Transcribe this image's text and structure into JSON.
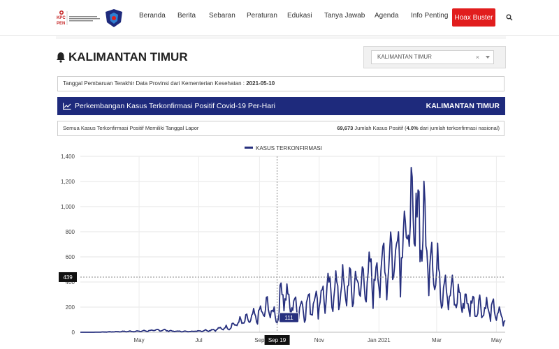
{
  "nav": {
    "logo_text": "KOMITE PENANGANAN COVID-19 DAN PEMULIHAN EKONOMI NASIONAL",
    "items": [
      "Beranda",
      "Berita",
      "Sebaran",
      "Peraturan",
      "Edukasi",
      "Tanya Jawab",
      "Agenda",
      "Info Penting"
    ],
    "hoax_label": "Hoax Buster"
  },
  "page": {
    "province_title": "KALIMANTAN TIMUR",
    "select_value": "KALIMANTAN TIMUR",
    "select_clear": "×",
    "update_label": "Tanggal Pembaruan Terakhir Data Provinsi dari Kementerian Kesehatan : ",
    "update_date": "2021-05-10",
    "bar_title": "Perkembangan Kasus Terkonfirmasi Positif Covid-19 Per-Hari",
    "bar_province": "KALIMANTAN TIMUR",
    "info_left": "Semua Kasus Terkonfirmasi Positif Memiliki Tanggal Lapor",
    "info_total": "69,673",
    "info_mid": " Jumlah Kasus Positif (",
    "info_pct": "4.0%",
    "info_end": " dari jumlah terkonfirmasi nasional)"
  },
  "colors": {
    "accent": "#1e2a7c",
    "hoax": "#e11d1d"
  },
  "chart_data": {
    "type": "line",
    "series": [
      {
        "name": "KASUS TERKONFIRMASI",
        "color": "#27307e"
      }
    ],
    "x_ticks": [
      "May",
      "Jul",
      "Sep",
      "Nov",
      "Jan 2021",
      "Mar",
      "May"
    ],
    "x_tick_dates": [
      "2020-05-01",
      "2020-07-01",
      "2020-09-01",
      "2020-11-01",
      "2021-01-01",
      "2021-03-01",
      "2021-05-01"
    ],
    "x_range": [
      "2020-03-02",
      "2021-05-10"
    ],
    "y_ticks": [
      "0",
      "200",
      "400",
      "600",
      "800",
      "1,000",
      "1,200",
      "1,400"
    ],
    "ylim": [
      0,
      1400
    ],
    "crosshair": {
      "x_label": "Sep 19",
      "y_label": "439",
      "value_label": "111"
    },
    "points": [
      [
        "2020-03-15",
        0
      ],
      [
        "2020-04-01",
        3
      ],
      [
        "2020-04-15",
        6
      ],
      [
        "2020-05-01",
        8
      ],
      [
        "2020-05-15",
        14
      ],
      [
        "2020-05-25",
        18
      ],
      [
        "2020-06-05",
        8
      ],
      [
        "2020-06-20",
        6
      ],
      [
        "2020-07-01",
        10
      ],
      [
        "2020-07-15",
        18
      ],
      [
        "2020-08-01",
        40
      ],
      [
        "2020-08-10",
        75
      ],
      [
        "2020-08-20",
        95
      ],
      [
        "2020-09-01",
        140
      ],
      [
        "2020-09-10",
        200
      ],
      [
        "2020-09-19",
        111
      ],
      [
        "2020-09-25",
        380
      ],
      [
        "2020-10-01",
        220
      ],
      [
        "2020-10-15",
        190
      ],
      [
        "2020-11-01",
        270
      ],
      [
        "2020-11-15",
        330
      ],
      [
        "2020-12-01",
        350
      ],
      [
        "2020-12-15",
        390
      ],
      [
        "2021-01-01",
        470
      ],
      [
        "2021-01-15",
        610
      ],
      [
        "2021-01-25",
        760
      ],
      [
        "2021-02-05",
        880
      ],
      [
        "2021-02-12",
        930
      ],
      [
        "2021-02-20",
        650
      ],
      [
        "2021-03-01",
        480
      ],
      [
        "2021-03-15",
        300
      ],
      [
        "2021-04-01",
        230
      ],
      [
        "2021-04-15",
        200
      ],
      [
        "2021-05-01",
        160
      ],
      [
        "2021-05-10",
        90
      ]
    ]
  }
}
